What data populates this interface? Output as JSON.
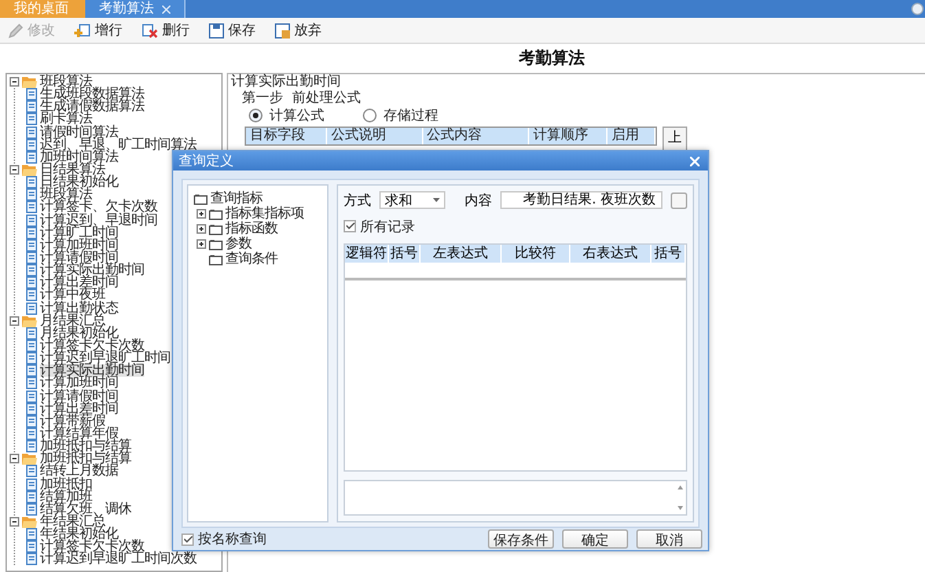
{
  "tabs": [
    {
      "label": "我的桌面",
      "selected": false,
      "closable": false
    },
    {
      "label": "考勤算法",
      "selected": true,
      "closable": true
    }
  ],
  "toolbar": [
    {
      "label": "修改",
      "kind": "pencil",
      "disabled": true
    },
    {
      "label": "增行",
      "kind": "add-row",
      "disabled": false
    },
    {
      "label": "删行",
      "kind": "delete-row",
      "disabled": false
    },
    {
      "label": "保存",
      "kind": "save",
      "disabled": false
    },
    {
      "label": "放弃",
      "kind": "discard",
      "disabled": false
    }
  ],
  "page_title": "考勤算法",
  "tree": [
    {
      "label": "班段算法",
      "expanded": true,
      "children": [
        {
          "label": "生成班段数据算法",
          "selected": false
        },
        {
          "label": "生成请假数据算法",
          "selected": false
        },
        {
          "label": "刷卡算法",
          "selected": false
        },
        {
          "label": "请假时间算法",
          "selected": false
        },
        {
          "label": "迟到、早退、旷工时间算法",
          "selected": false
        },
        {
          "label": "加班时间算法",
          "selected": false
        }
      ]
    },
    {
      "label": "日结果算法",
      "expanded": true,
      "children": [
        {
          "label": "日结果初始化",
          "selected": false
        },
        {
          "label": "班段算法",
          "selected": false
        },
        {
          "label": "计算签卡、欠卡次数",
          "selected": false
        },
        {
          "label": "计算迟到、早退时间",
          "selected": false
        },
        {
          "label": "计算旷工时间",
          "selected": false
        },
        {
          "label": "计算加班时间",
          "selected": false
        },
        {
          "label": "计算请假时间",
          "selected": false
        },
        {
          "label": "计算实际出勤时间",
          "selected": false
        },
        {
          "label": "计算出差时间",
          "selected": false
        },
        {
          "label": "计算中夜班",
          "selected": false
        },
        {
          "label": "计算出勤状态",
          "selected": false
        }
      ]
    },
    {
      "label": "月结果汇总",
      "expanded": true,
      "children": [
        {
          "label": "月结果初始化",
          "selected": false
        },
        {
          "label": "计算签卡欠卡次数",
          "selected": false
        },
        {
          "label": "计算迟到早退旷工时间",
          "selected": false
        },
        {
          "label": "计算实际出勤时间",
          "selected": true
        },
        {
          "label": "计算加班时间",
          "selected": false
        },
        {
          "label": "计算请假时间",
          "selected": false
        },
        {
          "label": "计算出差时间",
          "selected": false
        },
        {
          "label": "计算带薪假",
          "selected": false
        },
        {
          "label": "计算结算年假",
          "selected": false
        },
        {
          "label": "加班抵扣与结算",
          "selected": false
        }
      ]
    },
    {
      "label": "加班抵扣与结算",
      "expanded": true,
      "children": [
        {
          "label": "结转上月数据",
          "selected": false
        },
        {
          "label": "加班抵扣",
          "selected": false
        },
        {
          "label": "结算加班",
          "selected": false
        },
        {
          "label": "结算欠班、调休",
          "selected": false
        }
      ]
    },
    {
      "label": "年结果汇总",
      "expanded": true,
      "children": [
        {
          "label": "年结果初始化",
          "selected": false
        },
        {
          "label": "计算签卡欠卡次数",
          "selected": false
        },
        {
          "label": "计算迟到早退旷工时间次数",
          "selected": false
        }
      ]
    }
  ],
  "formula_panel": {
    "title": "计算实际出勤时间",
    "step": "第一步  前处理公式",
    "options": [
      {
        "label": "计算公式",
        "selected": true
      },
      {
        "label": "存储过程",
        "selected": false
      }
    ],
    "columns": [
      "目标字段",
      "公式说明",
      "公式内容",
      "计算顺序",
      "启用"
    ],
    "side_button": "上"
  },
  "dialog": {
    "title": "查询定义",
    "tree": [
      {
        "label": "查询指标",
        "children": [
          {
            "label": "指标集指标项",
            "expandable": true
          },
          {
            "label": "指标函数",
            "expandable": true
          },
          {
            "label": "参数",
            "expandable": true
          },
          {
            "label": "查询条件",
            "expandable": false
          }
        ]
      }
    ],
    "mode_label": "方式",
    "mode_value": "求和",
    "content_label": "内容",
    "content_value": "考勤日结果. 夜班次数",
    "all_records": {
      "label": "所有记录",
      "checked": true
    },
    "columns": [
      "逻辑符",
      "括号",
      "左表达式",
      "比较符",
      "右表达式",
      "括号"
    ],
    "by_name": {
      "label": "按名称查询",
      "checked": true
    },
    "buttons": [
      "保存条件",
      "确定",
      "取消"
    ]
  }
}
